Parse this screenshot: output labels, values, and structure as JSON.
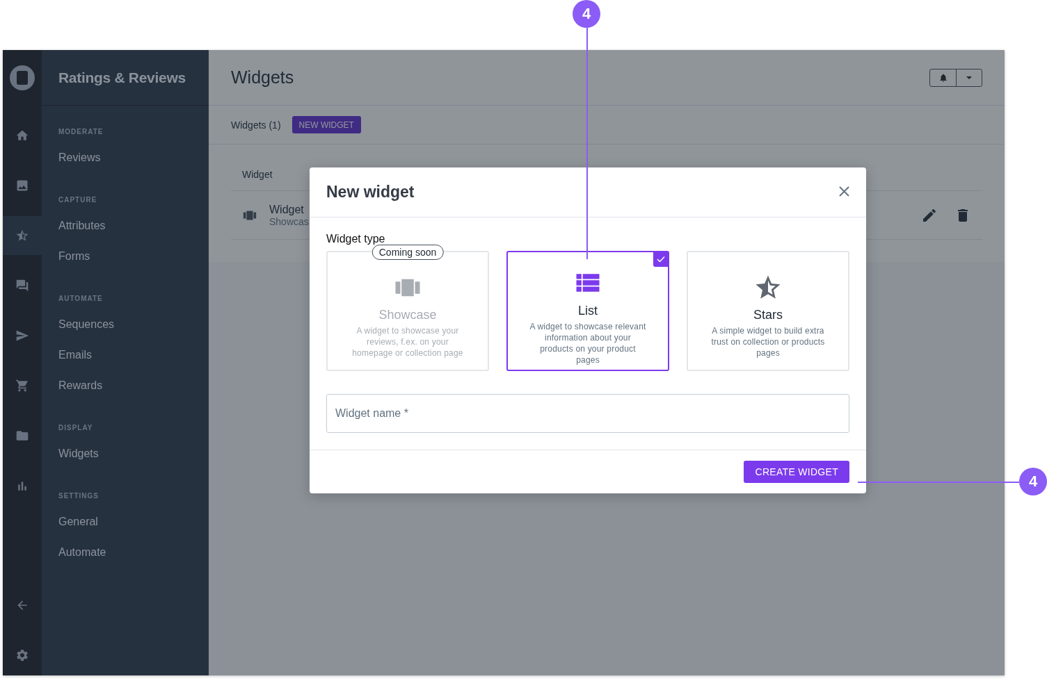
{
  "callouts": [
    {
      "label": "4"
    },
    {
      "label": "4"
    }
  ],
  "rail": {
    "items": [
      {
        "kind": "home",
        "selected": false
      },
      {
        "kind": "image",
        "selected": false
      },
      {
        "kind": "star",
        "selected": true
      },
      {
        "kind": "forum",
        "selected": false
      },
      {
        "kind": "send",
        "selected": false
      },
      {
        "kind": "cart",
        "selected": false
      },
      {
        "kind": "folder",
        "selected": false
      },
      {
        "kind": "chart",
        "selected": false
      }
    ],
    "bottom": [
      {
        "kind": "back",
        "selected": false
      },
      {
        "kind": "settings",
        "selected": false
      }
    ]
  },
  "sidebar": {
    "title": "Ratings & Reviews",
    "sections": [
      {
        "heading": "MODERATE",
        "items": [
          "Reviews"
        ]
      },
      {
        "heading": "CAPTURE",
        "items": [
          "Attributes",
          "Forms"
        ]
      },
      {
        "heading": "AUTOMATE",
        "items": [
          "Sequences",
          "Emails",
          "Rewards"
        ]
      },
      {
        "heading": "DISPLAY",
        "items": [
          "Widgets"
        ]
      },
      {
        "heading": "SETTINGS",
        "items": [
          "General",
          "Automate"
        ]
      }
    ]
  },
  "page": {
    "title": "Widgets",
    "count": "Widgets (1)",
    "new_button": "NEW WIDGET",
    "table": {
      "columns": [
        "Widget"
      ],
      "rows": [
        {
          "name": "Widget",
          "type": "Showcas"
        }
      ]
    }
  },
  "modal": {
    "title": "New widget",
    "section": "Widget type",
    "options": [
      {
        "kind": "showcase",
        "title": "Showcase",
        "description": "A widget to showcase your reviews, f.ex. on your homepage or collection page",
        "badge": "Coming soon",
        "disabled": true,
        "selected": false
      },
      {
        "kind": "list",
        "title": "List",
        "description": "A widget to showcase relevant information about your products on your product pages",
        "disabled": false,
        "selected": true
      },
      {
        "kind": "stars",
        "title": "Stars",
        "description": "A simple widget to build extra trust on collection or products pages",
        "disabled": false,
        "selected": false
      }
    ],
    "field": {
      "placeholder": "Widget name *"
    },
    "submit": "CREATE WIDGET"
  }
}
